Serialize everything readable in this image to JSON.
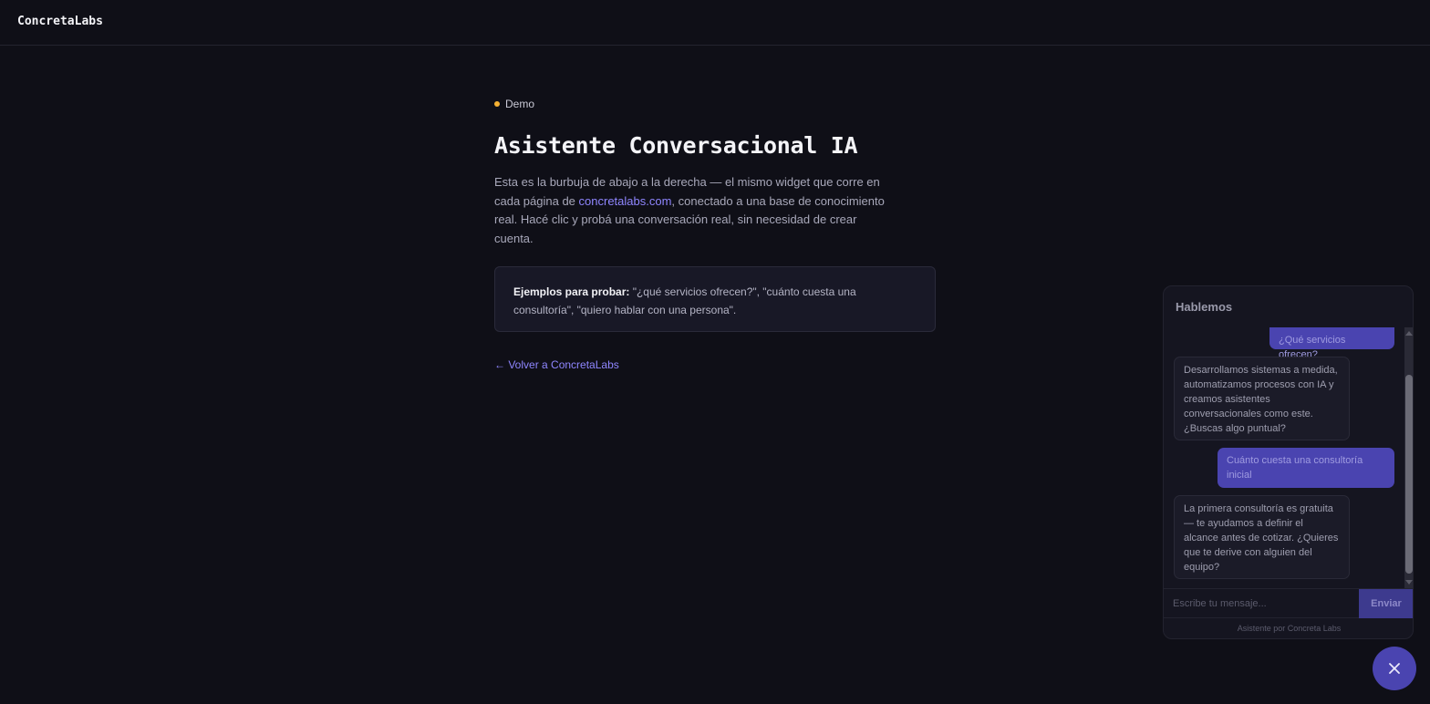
{
  "header": {
    "brand": "ConcretaLabs"
  },
  "main": {
    "eyebrow": "Demo",
    "title": "Asistente Conversacional IA",
    "desc_1": "Esta es la burbuja de abajo a la derecha — el mismo widget que corre en cada página de ",
    "desc_link": "concretalabs.com",
    "desc_2": ", conectado a una base de conocimiento real. Hacé clic y probá una conversación real, sin necesidad de crear cuenta.",
    "examples_label": "Ejemplos para probar:",
    "examples_text": " \"¿qué servicios ofrecen?\", \"cuánto cuesta una consultoría\", \"quiero hablar con una persona\".",
    "back_link": "← Volver a ConcretaLabs"
  },
  "chat": {
    "title": "Hablemos",
    "messages": [
      {
        "role": "user",
        "text": "¿Qué servicios ofrecen?"
      },
      {
        "role": "bot",
        "text": "Desarrollamos sistemas a medida, automatizamos procesos con IA y creamos asistentes conversacionales como este. ¿Buscas algo puntual?"
      },
      {
        "role": "user",
        "text": "Cuánto cuesta una consultoría inicial"
      },
      {
        "role": "bot",
        "text": "La primera consultoría es gratuita — te ayudamos a definir el alcance antes de cotizar. ¿Quieres que te derive con alguien del equipo?"
      }
    ],
    "input_placeholder": "Escribe tu mensaje...",
    "send_label": "Enviar",
    "footer": "Asistente por Concreta Labs"
  },
  "fab": {
    "icon": "close-icon"
  }
}
